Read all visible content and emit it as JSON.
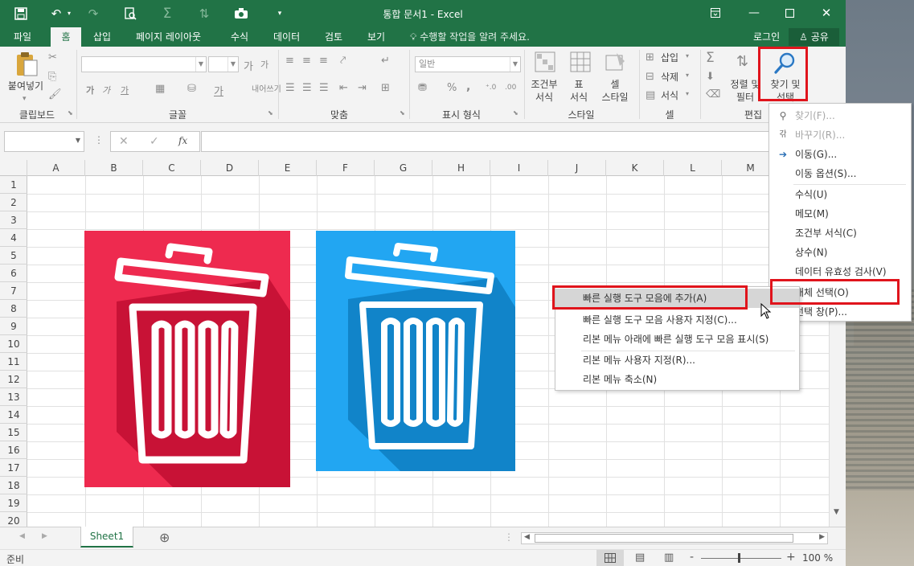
{
  "title_bar": {
    "title": "통합 문서1 - Excel",
    "qat_icons": [
      "save-icon",
      "undo-icon",
      "redo-icon",
      "print-preview-icon",
      "sum-icon",
      "sort-icon",
      "camera-icon",
      "customize-qat-icon"
    ],
    "window_buttons": [
      "ribbon-display-icon",
      "minimize-icon",
      "maximize-icon",
      "close-icon"
    ]
  },
  "tabs": [
    {
      "label": "파일"
    },
    {
      "label": "홈"
    },
    {
      "label": "삽입"
    },
    {
      "label": "페이지 레이아웃"
    },
    {
      "label": "수식"
    },
    {
      "label": "데이터"
    },
    {
      "label": "검토"
    },
    {
      "label": "보기"
    }
  ],
  "tell_me": "수행할 작업을 알려 주세요.",
  "login": "로그인",
  "share": "공유",
  "ribbon": {
    "groups": {
      "clipboard": "클립보드",
      "font": "글꼴",
      "alignment": "맞춤",
      "number": "표시 형식",
      "styles": "스타일",
      "cells": "셀",
      "editing": "편집"
    },
    "paste": "붙여넣기",
    "number_format": "일반",
    "font_buttons": [
      "가",
      "가",
      "가"
    ],
    "wrap": "내어쓰기",
    "percent": "%",
    "comma": ",",
    "conditional": [
      "조건부",
      "서식"
    ],
    "table": [
      "표",
      "서식"
    ],
    "cell_style": [
      "셀",
      "스타일"
    ],
    "insert": "삽입",
    "delete": "삭제",
    "format": "서식",
    "sort": [
      "정렬 및",
      "필터"
    ],
    "find": [
      "찾기 및",
      "선택"
    ]
  },
  "formula_bar": {
    "fx": "fx",
    "cancel": "✕",
    "enter": "✓"
  },
  "grid": {
    "columns": [
      "A",
      "B",
      "C",
      "D",
      "E",
      "F",
      "G",
      "H",
      "I",
      "J",
      "K",
      "L",
      "M"
    ],
    "rows": [
      "1",
      "2",
      "3",
      "4",
      "5",
      "6",
      "7",
      "8",
      "9",
      "10",
      "11",
      "12",
      "13",
      "14",
      "15",
      "16",
      "17",
      "18",
      "19",
      "20"
    ]
  },
  "images": {
    "left": {
      "icon": "trash-icon",
      "bg": "#ee2a4f",
      "shade": "#c81236"
    },
    "right": {
      "icon": "trash-icon",
      "bg": "#22a6f2",
      "shade": "#1184c9"
    }
  },
  "find_menu": {
    "items": [
      {
        "label": "찾기(F)...",
        "icon": "search-icon",
        "dim": true
      },
      {
        "label": "바꾸기(R)...",
        "icon": "replace-icon",
        "dim": true
      },
      {
        "label": "이동(G)...",
        "icon": "arrow-right-icon",
        "dim": false
      },
      {
        "label": "이동 옵션(S)...",
        "icon": "",
        "dim": false
      },
      {
        "label": "수식(U)",
        "icon": "",
        "dim": false
      },
      {
        "label": "메모(M)",
        "icon": "",
        "dim": false
      },
      {
        "label": "조건부 서식(C)",
        "icon": "",
        "dim": false
      },
      {
        "label": "상수(N)",
        "icon": "",
        "dim": false
      },
      {
        "label": "데이터 유효성 검사(V)",
        "icon": "",
        "dim": false
      },
      {
        "label": "개체 선택(O)",
        "icon": "select-objects-icon",
        "dim": false
      },
      {
        "label": "선택 창(P)...",
        "icon": "selection-pane-icon",
        "dim": false
      }
    ]
  },
  "context_menu": {
    "items": [
      {
        "label": "빠른 실행 도구 모음에 추가(A)"
      },
      {
        "label": "빠른 실행 도구 모음 사용자 지정(C)..."
      },
      {
        "label": "리본 메뉴 아래에 빠른 실행 도구 모음 표시(S)"
      },
      {
        "label": "리본 메뉴 사용자 지정(R)..."
      },
      {
        "label": "리본 메뉴 축소(N)"
      }
    ]
  },
  "sheet_tab": "Sheet1",
  "status": {
    "ready": "준비",
    "zoom": "100 %",
    "zoom_minus": "-",
    "zoom_plus": "+"
  },
  "colors": {
    "excel_green": "#217346",
    "highlight_red": "#e0141c"
  }
}
